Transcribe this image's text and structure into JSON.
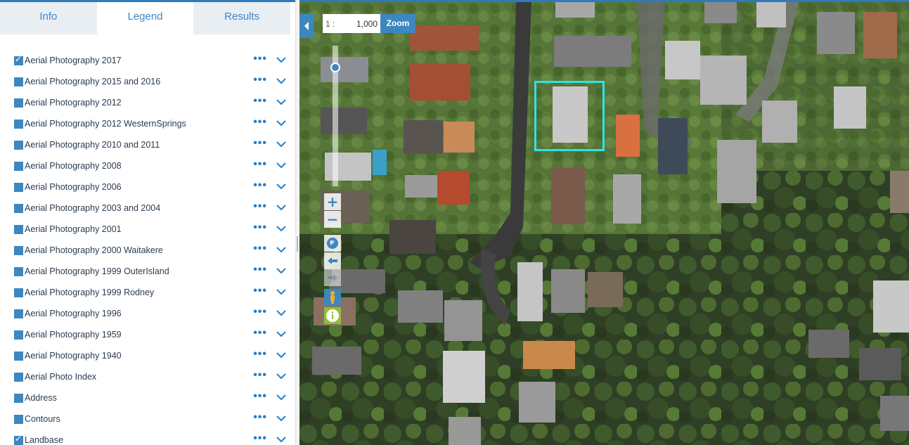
{
  "tabs": [
    {
      "label": "Info",
      "active": false
    },
    {
      "label": "Legend",
      "active": true
    },
    {
      "label": "Results",
      "active": false
    }
  ],
  "layers": [
    {
      "label": "Aerial Photography 2017",
      "checked": true
    },
    {
      "label": "Aerial Photography 2015 and 2016",
      "checked": false
    },
    {
      "label": "Aerial Photography 2012",
      "checked": false
    },
    {
      "label": "Aerial Photography 2012 WesternSprings",
      "checked": false
    },
    {
      "label": "Aerial Photography 2010 and 2011",
      "checked": false
    },
    {
      "label": "Aerial Photography 2008",
      "checked": false
    },
    {
      "label": "Aerial Photography 2006",
      "checked": false
    },
    {
      "label": "Aerial Photography 2003 and 2004",
      "checked": false
    },
    {
      "label": "Aerial Photography 2001",
      "checked": false
    },
    {
      "label": "Aerial Photography 2000 Waitakere",
      "checked": false
    },
    {
      "label": "Aerial Photography 1999 OuterIsland",
      "checked": false
    },
    {
      "label": "Aerial Photography 1999 Rodney",
      "checked": false
    },
    {
      "label": "Aerial Photography 1996",
      "checked": false
    },
    {
      "label": "Aerial Photography 1959",
      "checked": false
    },
    {
      "label": "Aerial Photography 1940",
      "checked": false
    },
    {
      "label": "Aerial Photo Index",
      "checked": false
    },
    {
      "label": "Address",
      "checked": false
    },
    {
      "label": "Contours",
      "checked": false
    },
    {
      "label": "Landbase",
      "checked": true
    }
  ],
  "layer_more": "•••",
  "map": {
    "scale_prefix": "1 :",
    "scale_value": "1,000",
    "zoom_label": "Zoom",
    "zoom_in": "+",
    "zoom_out": "−",
    "controls": [
      "zoom-in-icon",
      "zoom-out-icon",
      "globe-icon",
      "back-arrow-icon",
      "forward-arrow-icon",
      "street-view-person-icon",
      "info-icon"
    ]
  },
  "colors": {
    "accent": "#3d87c0",
    "selection": "#2fe3e3",
    "tab_bg": "#e9eef3"
  }
}
